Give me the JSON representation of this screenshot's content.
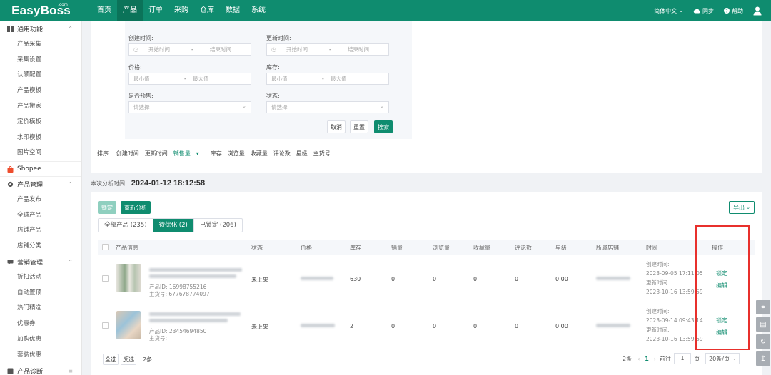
{
  "app": {
    "logo": "EasyBoss",
    "logo_sup": ".com"
  },
  "nav": [
    "首页",
    "产品",
    "订单",
    "采购",
    "仓库",
    "数据",
    "系统"
  ],
  "nav_active": 1,
  "top_right": {
    "language": "简体中文",
    "sync": "同步",
    "help": "帮助"
  },
  "sidebar": {
    "general": "通用功能",
    "general_items": [
      "产品采集",
      "采集设置",
      "认领配置",
      "产品模板",
      "产品搬家",
      "定价模板",
      "水印模板",
      "图片空间"
    ],
    "shopee": "Shopee",
    "product_mgmt": "产品管理",
    "product_items": [
      "产品发布",
      "全球产品",
      "店铺产品",
      "店铺分类"
    ],
    "marketing": "营销管理",
    "marketing_items": [
      "折扣活动",
      "自动置顶",
      "热门精选",
      "优惠券",
      "加购优惠",
      "套装优惠"
    ],
    "diagnosis": "产品诊断"
  },
  "filters": {
    "created_label": "创建时间:",
    "updated_label": "更新时间:",
    "start_placeholder": "开始时间",
    "end_placeholder": "结束时间",
    "range_sep": "-",
    "price_label": "价格:",
    "stock_label": "库存:",
    "min_placeholder": "最小值",
    "max_placeholder": "最大值",
    "presale_label": "是否预售:",
    "status_label": "状态:",
    "select_placeholder": "请选择",
    "cancel": "取消",
    "reset": "重置",
    "search": "搜索"
  },
  "sort": {
    "label": "排序:",
    "options": [
      "创建时间",
      "更新时间",
      "销售量",
      "库存",
      "浏览量",
      "收藏量",
      "评论数",
      "星级",
      "主货号"
    ],
    "selected_index": 2
  },
  "analysis": {
    "label": "本次分析时间:",
    "time": "2024-01-12 18:12:58"
  },
  "toolbar": {
    "lock": "锁定",
    "reanalyze": "重新分析",
    "export": "导出"
  },
  "tabs": [
    "全部产品 (235)",
    "待优化 (2)",
    "已锁定 (206)"
  ],
  "tab_active": 1,
  "columns": [
    "产品信息",
    "状态",
    "价格",
    "库存",
    "销量",
    "浏览量",
    "收藏量",
    "评论数",
    "星级",
    "所属店铺",
    "时间",
    "操作"
  ],
  "rows": [
    {
      "product_id": "产品ID: 16998755216",
      "sku": "主货号: 677678774097",
      "status": "未上架",
      "stock": "630",
      "sales": "0",
      "views": "0",
      "favorites": "0",
      "reviews": "0",
      "rating": "0.00",
      "created_label": "创建时间:",
      "created": "2023-09-05 17:11:05",
      "updated_label": "更新时间:",
      "updated": "2023-10-16 13:59:59",
      "action_lock": "锁定",
      "action_edit": "编辑"
    },
    {
      "product_id": "产品ID: 23454694850",
      "sku": "主货号:",
      "status": "未上架",
      "stock": "2",
      "sales": "0",
      "views": "0",
      "favorites": "0",
      "reviews": "0",
      "rating": "0.00",
      "created_label": "创建时间:",
      "created": "2023-09-14 09:43:14",
      "updated_label": "更新时间:",
      "updated": "2023-10-16 13:59:59",
      "action_lock": "锁定",
      "action_edit": "编辑"
    }
  ],
  "footer": {
    "select_all": "全选",
    "invert": "反选",
    "count": "2条",
    "total": "2条",
    "page": "1",
    "goto": "前往",
    "page_input": "1",
    "page_unit": "页",
    "page_size": "20条/页"
  },
  "colors": {
    "brand": "#0f8c6f",
    "highlight": "#e8302c"
  }
}
